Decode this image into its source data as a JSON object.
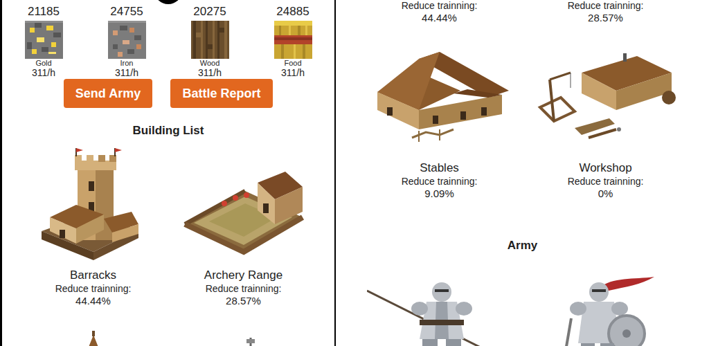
{
  "resources": [
    {
      "amount": "21185",
      "name": "Gold",
      "rate": "311/h"
    },
    {
      "amount": "24755",
      "name": "Iron",
      "rate": "311/h"
    },
    {
      "amount": "20275",
      "name": "Wood",
      "rate": "311/h"
    },
    {
      "amount": "24885",
      "name": "Food",
      "rate": "311/h"
    }
  ],
  "buttons": [
    "Send Army",
    "Battle Report"
  ],
  "left": {
    "heading": "Building List",
    "buildings": [
      {
        "name": "Barracks",
        "caption": "Reduce trainning:",
        "value": "44.44%"
      },
      {
        "name": "Archery Range",
        "caption": "Reduce trainning:",
        "value": "28.57%"
      }
    ]
  },
  "right": {
    "top_buildings": [
      {
        "caption": "Reduce trainning:",
        "value": "44.44%"
      },
      {
        "caption": "Reduce trainning:",
        "value": "28.57%"
      }
    ],
    "buildings": [
      {
        "name": "Stables",
        "caption": "Reduce trainning:",
        "value": "9.09%"
      },
      {
        "name": "Workshop",
        "caption": "Reduce trainning:",
        "value": "0%"
      }
    ],
    "heading": "Army"
  }
}
